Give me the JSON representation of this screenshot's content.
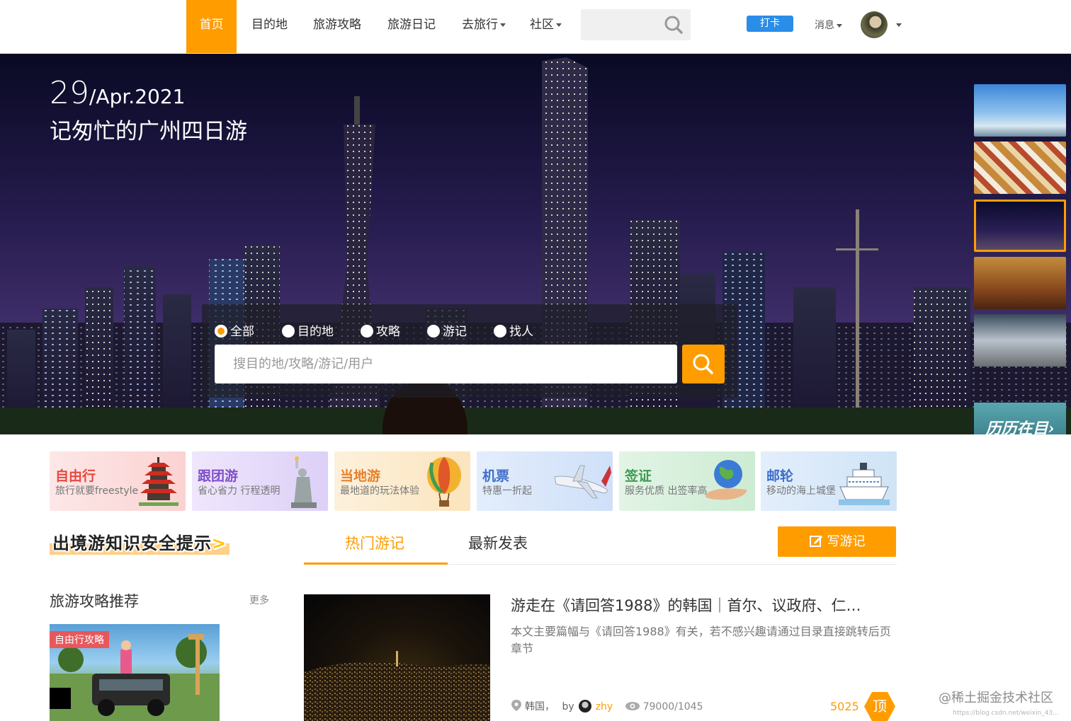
{
  "nav": {
    "items": [
      {
        "label": "首页",
        "active": true
      },
      {
        "label": "目的地",
        "active": false
      },
      {
        "label": "旅游攻略",
        "active": false
      },
      {
        "label": "旅游日记",
        "active": false
      },
      {
        "label": "去旅行",
        "active": false,
        "dropdown": true
      },
      {
        "label": "社区",
        "active": false,
        "dropdown": true
      }
    ],
    "checkin_label": "打卡",
    "message_label": "消息",
    "accent": "#ff9d00",
    "checkin_color": "#2a8de8"
  },
  "hero": {
    "day": "29",
    "month_year": "/Apr.2021",
    "title": "记匆忙的广州四日游",
    "filters": [
      "全部",
      "目的地",
      "攻略",
      "游记",
      "找人"
    ],
    "selected_filter": "全部",
    "search_placeholder": "搜目的地/攻略/游记/用户",
    "thumbs_cta": "历历在目›"
  },
  "categories": [
    {
      "title": "自由行",
      "subtitle": "旅行就要freestyle",
      "title_color": "#e8483d",
      "bg": "#fde3e3",
      "icon": "pagoda-icon"
    },
    {
      "title": "跟团游",
      "subtitle": "省心省力 行程透明",
      "title_color": "#7d4fc8",
      "bg": "#ece3fb",
      "icon": "statue-of-liberty-icon"
    },
    {
      "title": "当地游",
      "subtitle": "最地道的玩法体验",
      "title_color": "#e8802b",
      "bg": "#fdf0d8",
      "icon": "hot-air-balloon-icon"
    },
    {
      "title": "机票",
      "subtitle": "特惠一折起",
      "title_color": "#3f6fc9",
      "bg": "#e1ecfb",
      "icon": "airplane-icon"
    },
    {
      "title": "签证",
      "subtitle": "服务优质 出签率高",
      "title_color": "#3e9b52",
      "bg": "#e0f3e4",
      "icon": "globe-hand-icon"
    },
    {
      "title": "邮轮",
      "subtitle": "移动的海上城堡",
      "title_color": "#3f6fc9",
      "bg": "#e1eefb",
      "icon": "cruise-ship-icon"
    }
  ],
  "safety_banner": "出境游知识安全提示",
  "tabs": {
    "items": [
      "热门游记",
      "最新发表"
    ],
    "active": "热门游记",
    "write_label": "写游记"
  },
  "side": {
    "title": "旅游攻略推荐",
    "more": "更多",
    "tag": "自由行攻略"
  },
  "article": {
    "title": "游走在《请回答1988》的韩国｜首尔、议政府、仁…",
    "description": "本文主要篇幅与《请回答1988》有关，若不感兴趣请通过目录直接跳转后页章节",
    "location": "韩国，",
    "by": "by",
    "author": "zhy",
    "views": "79000/1045",
    "likes": "5025",
    "top_badge": "顶"
  },
  "watermark": "@稀土掘金技术社区",
  "watermark_url": "https://blog.csdn.net/weixin_43..."
}
